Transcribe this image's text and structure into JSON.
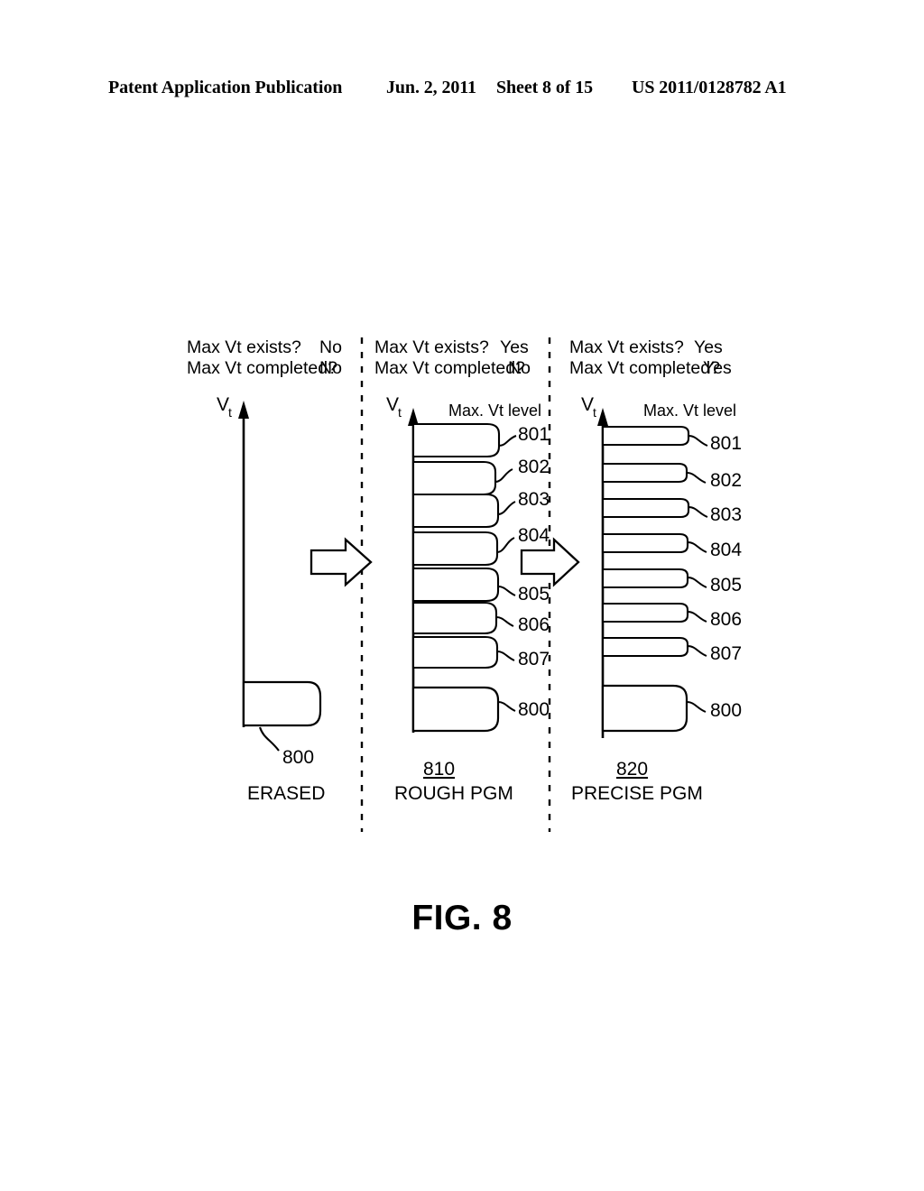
{
  "header": {
    "publication": "Patent Application Publication",
    "date": "Jun. 2, 2011",
    "sheet": "Sheet 8 of 15",
    "patent_number": "US 2011/0128782 A1"
  },
  "figure": {
    "caption": "FIG. 8",
    "axis_label_main": "V",
    "axis_label_sub": "t",
    "max_vt_level_label": "Max. Vt level",
    "question_exists": "Max Vt exists?",
    "question_completed": "Max Vt completed?"
  },
  "panels": [
    {
      "id": "erased",
      "caption": "ERASED",
      "ref_number": "",
      "status": {
        "exists": "No",
        "completed": "No"
      },
      "has_max_vt_level_label": false,
      "distributions": [
        {
          "label": "800",
          "kind": "erased"
        }
      ]
    },
    {
      "id": "rough-pgm",
      "caption": "ROUGH PGM",
      "ref_number": "810",
      "status": {
        "exists": "Yes",
        "completed": "No"
      },
      "has_max_vt_level_label": true,
      "distributions": [
        {
          "label": "801",
          "kind": "program"
        },
        {
          "label": "802",
          "kind": "program"
        },
        {
          "label": "803",
          "kind": "program"
        },
        {
          "label": "804",
          "kind": "program"
        },
        {
          "label": "805",
          "kind": "program"
        },
        {
          "label": "806",
          "kind": "program"
        },
        {
          "label": "807",
          "kind": "program"
        },
        {
          "label": "800",
          "kind": "erased"
        }
      ]
    },
    {
      "id": "precise-pgm",
      "caption": "PRECISE PGM",
      "ref_number": "820",
      "status": {
        "exists": "Yes",
        "completed": "Yes"
      },
      "has_max_vt_level_label": true,
      "distributions": [
        {
          "label": "801",
          "kind": "program"
        },
        {
          "label": "802",
          "kind": "program"
        },
        {
          "label": "803",
          "kind": "program"
        },
        {
          "label": "804",
          "kind": "program"
        },
        {
          "label": "805",
          "kind": "program"
        },
        {
          "label": "806",
          "kind": "program"
        },
        {
          "label": "807",
          "kind": "program"
        },
        {
          "label": "800",
          "kind": "erased"
        }
      ]
    }
  ],
  "arrows": [
    {
      "name": "arrow-erased-to-rough"
    },
    {
      "name": "arrow-rough-to-precise"
    }
  ],
  "colors": {
    "ink": "#000000",
    "paper": "#ffffff"
  }
}
